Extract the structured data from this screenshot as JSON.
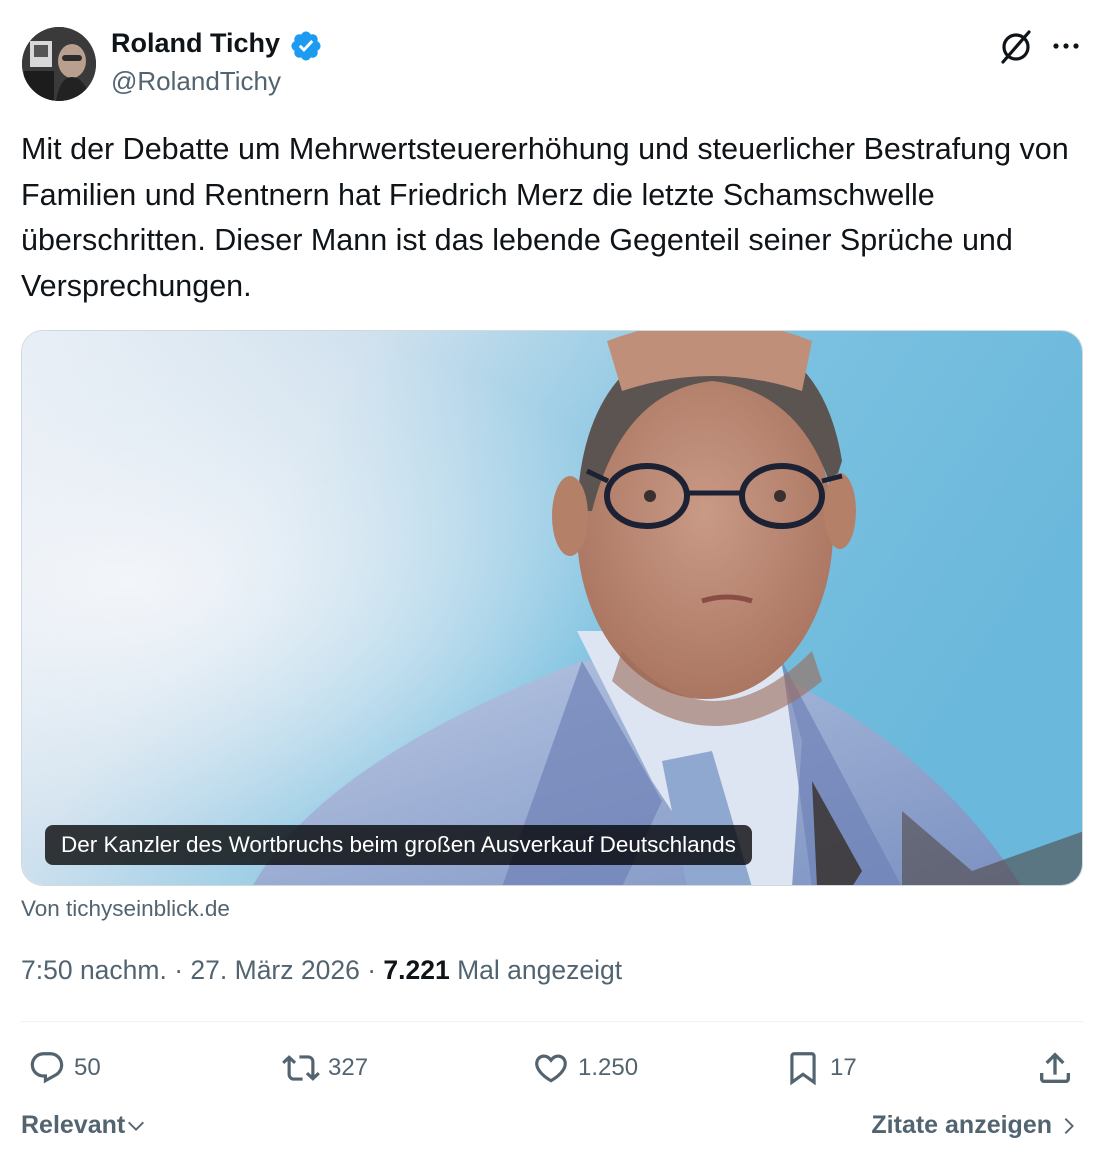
{
  "author": {
    "name": "Roland Tichy",
    "handle": "@RolandTichy"
  },
  "tweet": {
    "text": "Mit der Debatte um Mehrwertsteuererhöhung und steuerlicher Bestrafung von Familien und Rentnern hat Friedrich Merz die letzte Schamschwelle überschritten. Dieser Mann ist das lebende Gegenteil seiner Sprüche und Versprechungen."
  },
  "card": {
    "caption": "Der Kanzler des Wortbruchs beim großen Ausverkauf Deutschlands",
    "source": "Von tichyseinblick.de"
  },
  "meta": {
    "time": "7:50 nachm.",
    "date": "27. März 2026",
    "separator": "·",
    "views": "7.221",
    "views_label": "Mal angezeigt"
  },
  "actions": {
    "replies": "50",
    "reposts": "327",
    "likes": "1.250",
    "bookmarks": "17"
  },
  "footer": {
    "sort_label": "Relevant",
    "quotes_label": "Zitate anzeigen"
  },
  "colors": {
    "verified": "#1d9bf0",
    "secondary_text": "#536471",
    "primary_text": "#0f1419"
  },
  "icons": [
    "verified-badge-icon",
    "grok-icon",
    "more-icon",
    "reply-icon",
    "repost-icon",
    "like-icon",
    "bookmark-icon",
    "share-icon",
    "chevron-down-icon",
    "chevron-right-icon"
  ]
}
